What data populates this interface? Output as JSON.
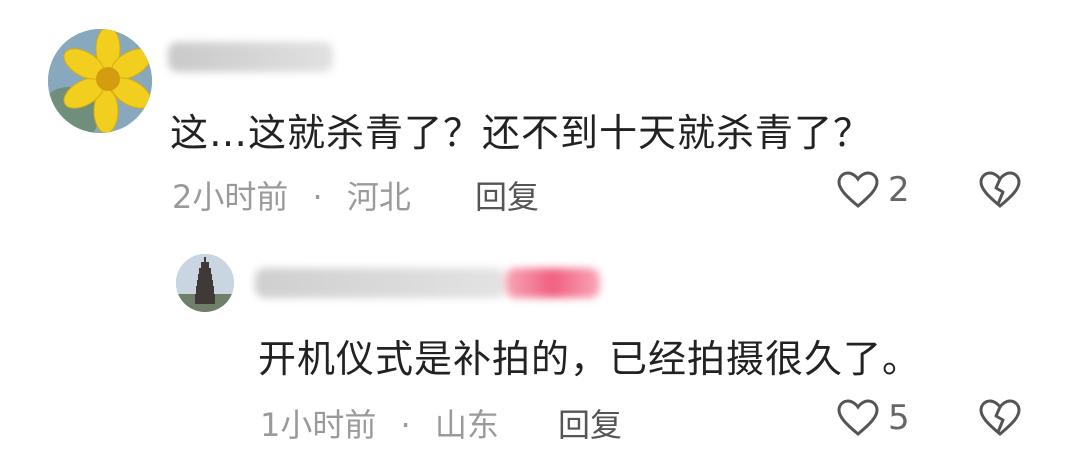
{
  "comments": [
    {
      "text": "这…这就杀青了？还不到十天就杀青了？",
      "time": "2小时前",
      "location": "河北",
      "reply_label": "回复",
      "likes": "2",
      "avatar_icon": "yellow-flower-avatar"
    },
    {
      "text": "开机仪式是补拍的，已经拍摄很久了。",
      "time": "1小时前",
      "location": "山东",
      "reply_label": "回复",
      "likes": "5",
      "avatar_icon": "pagoda-avatar"
    }
  ],
  "separator": "·",
  "colors": {
    "meta": "#9a9a9a",
    "text": "#222222",
    "icon": "#555555",
    "blur_pink": "#f06080"
  }
}
